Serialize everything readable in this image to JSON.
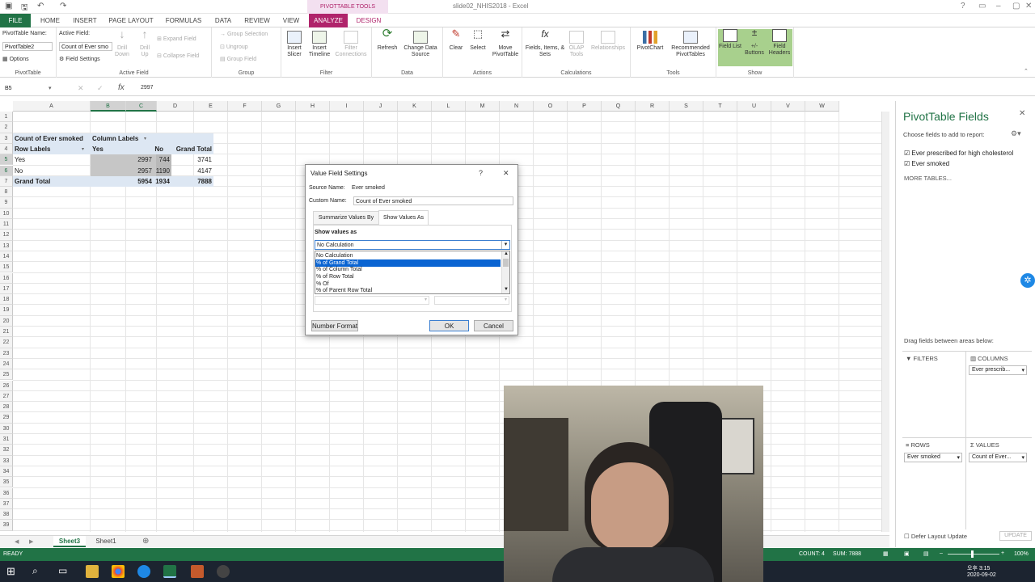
{
  "title_bar": {
    "context_label": "PIVOTTABLE TOOLS",
    "doc_title": "slide02_NHIS2018 - Excel"
  },
  "tabs": [
    "FILE",
    "HOME",
    "INSERT",
    "PAGE LAYOUT",
    "FORMULAS",
    "DATA",
    "REVIEW",
    "VIEW",
    "ANALYZE",
    "DESIGN"
  ],
  "ribbon": {
    "pt_name_label": "PivotTable Name:",
    "pt_name_value": "PivotTable2",
    "options_label": "Options",
    "active_field_label": "Active Field:",
    "active_field_value": "Count of Ever smo",
    "field_settings_label": "Field Settings",
    "drill_down": "Drill Down",
    "drill_up": "Drill Up",
    "expand_field": "Expand Field",
    "collapse_field": "Collapse Field",
    "group_selection": "Group Selection",
    "ungroup": "Ungroup",
    "group_field": "Group Field",
    "insert_slicer": "Insert Slicer",
    "insert_timeline": "Insert Timeline",
    "filter_connections": "Filter Connections",
    "refresh": "Refresh",
    "change_data_source": "Change Data Source",
    "clear": "Clear",
    "select": "Select",
    "move_pivottable": "Move PivotTable",
    "fields_items_sets": "Fields, Items, & Sets",
    "olap_tools": "OLAP Tools",
    "relationships": "Relationships",
    "pivotchart": "PivotChart",
    "recommended_pivottables": "Recommended PivotTables",
    "field_list": "Field List",
    "buttons": "+/- Buttons",
    "field_headers": "Field Headers",
    "groups": {
      "pivottable": "PivotTable",
      "active_field": "Active Field",
      "group": "Group",
      "filter": "Filter",
      "data": "Data",
      "actions": "Actions",
      "calculations": "Calculations",
      "tools": "Tools",
      "show": "Show"
    }
  },
  "formula_bar": {
    "name_box": "B5",
    "fx": "fx",
    "value": "2997"
  },
  "columns": [
    "A",
    "B",
    "C",
    "D",
    "E",
    "F",
    "G",
    "H",
    "I",
    "J",
    "K",
    "L",
    "M",
    "N",
    "O",
    "P",
    "Q",
    "R",
    "S",
    "T",
    "U",
    "V",
    "W"
  ],
  "rows": [
    "1",
    "2",
    "3",
    "4",
    "5",
    "6",
    "7",
    "8",
    "9",
    "10",
    "11",
    "12",
    "13",
    "14",
    "15",
    "16",
    "17",
    "18",
    "19",
    "20",
    "21",
    "22",
    "23",
    "24",
    "25",
    "26",
    "27",
    "28",
    "29",
    "30",
    "31",
    "32",
    "33",
    "34",
    "35",
    "36",
    "37",
    "38",
    "39"
  ],
  "pivot": {
    "title": "Count of Ever smoked",
    "col_labels": "Column Labels",
    "row_labels": "Row Labels",
    "h_yes": "Yes",
    "h_no": "No",
    "h_total": "Grand Total",
    "r1": {
      "label": "Yes",
      "yes": "2997",
      "no": "744",
      "total": "3741"
    },
    "r2": {
      "label": "No",
      "yes": "2957",
      "no": "1190",
      "total": "4147"
    },
    "gt": {
      "label": "Grand Total",
      "yes": "5954",
      "no": "1934",
      "total": "7888"
    }
  },
  "dialog": {
    "title": "Value Field Settings",
    "help": "?",
    "close": "✕",
    "source_label": "Source Name:",
    "source_value": "Ever smoked",
    "custom_label": "Custom Name:",
    "custom_value": "Count of Ever smoked",
    "tab1": "Summarize Values By",
    "tab2": "Show Values As",
    "show_values_label": "Show values as",
    "selected": "No Calculation",
    "options": [
      "No Calculation",
      "% of Grand Total",
      "% of Column Total",
      "% of Row Total",
      "% Of",
      "% of Parent Row Total"
    ],
    "number_format": "Number Format",
    "ok": "OK",
    "cancel": "Cancel"
  },
  "pane": {
    "title": "PivotTable Fields",
    "subtitle": "Choose fields to add to report:",
    "fields": [
      "Ever prescribed for high cholesterol",
      "Ever smoked"
    ],
    "more_tables": "MORE TABLES...",
    "drag_label": "Drag fields between areas below:",
    "filters": "FILTERS",
    "columns": "COLUMNS",
    "rows": "ROWS",
    "values": "VALUES",
    "columns_item": "Ever prescrib...",
    "rows_item": "Ever smoked",
    "values_item": "Count of Ever...",
    "defer": "Defer Layout Update",
    "update": "UPDATE"
  },
  "sheets": [
    "Sheet3",
    "Sheet1"
  ],
  "status": {
    "ready": "READY",
    "count": "COUNT: 4",
    "sum": "SUM: 7888",
    "zoom": "100%"
  },
  "taskbar": {
    "time": "오후 3:15",
    "date": "2020-09-02"
  },
  "colors": {
    "excel_green": "#217346",
    "pivot_tab": "#b0246b",
    "selection_blue": "#0a64d2"
  }
}
